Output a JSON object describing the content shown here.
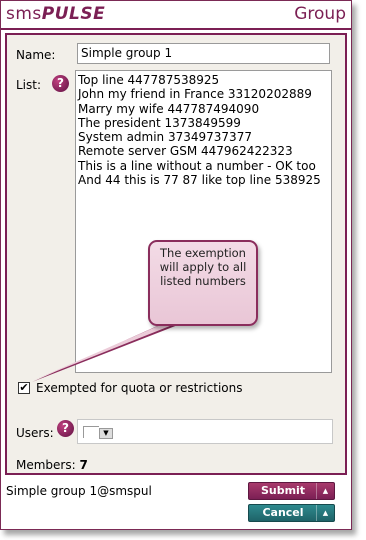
{
  "header": {
    "brand_part1": "sms",
    "brand_part2": "PULSE",
    "title": "Group"
  },
  "form": {
    "name_label": "Name:",
    "name_value": "Simple group 1",
    "list_label": "List:",
    "list_help_icon": "question-icon",
    "list_lines": [
      "Top line 447787538925",
      "John my friend in France 33120202889",
      "Marry my wife 447787494090",
      "The president 1373849599",
      "System admin 37349737377",
      "Remote server GSM 447962422323",
      "This is a line without a number - OK too",
      "And 44 this is 77 87 like top line 538925"
    ],
    "tooltip_text": "The exemption will apply to all listed numbers",
    "exempt_label": "Exempted for quota or restrictions",
    "exempt_checked": true,
    "users_label": "Users:",
    "members_label": "Members:",
    "members_count": "7"
  },
  "footer": {
    "address": "Simple group 1@smspul",
    "submit_label": "Submit",
    "cancel_label": "Cancel"
  },
  "colors": {
    "brand": "#7b1f54",
    "submit": "#8e2b5e",
    "cancel": "#257276"
  }
}
